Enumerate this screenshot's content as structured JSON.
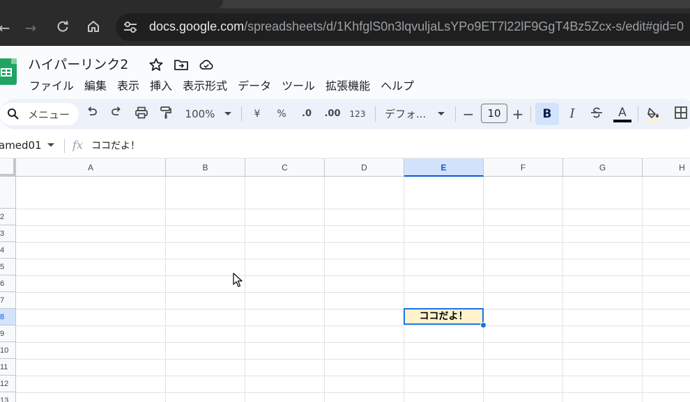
{
  "browser": {
    "url_host": "docs.google.com",
    "url_path": "/spreadsheets/d/1KhfglS0n3lqvuljaLsYPo9ET7l22lF9GgT4Bz5Zcx-s/edit#gid=0"
  },
  "doc": {
    "title": "ハイパーリンク2"
  },
  "menu": [
    "ファイル",
    "編集",
    "表示",
    "挿入",
    "表示形式",
    "データ",
    "ツール",
    "拡張機能",
    "ヘルプ"
  ],
  "toolbar": {
    "search_label": "メニュー",
    "zoom": "100%",
    "currency": "¥",
    "percent": "%",
    "decrease_decimal": ".0",
    "increase_decimal": ".00",
    "number_format": "123",
    "font": "デフォ...",
    "font_size": "10",
    "bold": "B",
    "italic": "I",
    "text_color": "A"
  },
  "formula_bar": {
    "name_box": "amed01",
    "fx": "fx",
    "content": "ココだよ！"
  },
  "grid": {
    "columns": [
      "A",
      "B",
      "C",
      "D",
      "E",
      "F",
      "G",
      "H"
    ],
    "selected_column": "E",
    "rows": [
      "",
      "2",
      "3",
      "4",
      "5",
      "6",
      "7",
      "8",
      "9",
      "10",
      "11",
      "12",
      "13"
    ],
    "selected_row": "8",
    "active_cell_value": "ココだよ！"
  },
  "colors": {
    "accent": "#1a73e8",
    "cell_fill": "#fff2cc",
    "sheets_green": "#1fa463"
  }
}
